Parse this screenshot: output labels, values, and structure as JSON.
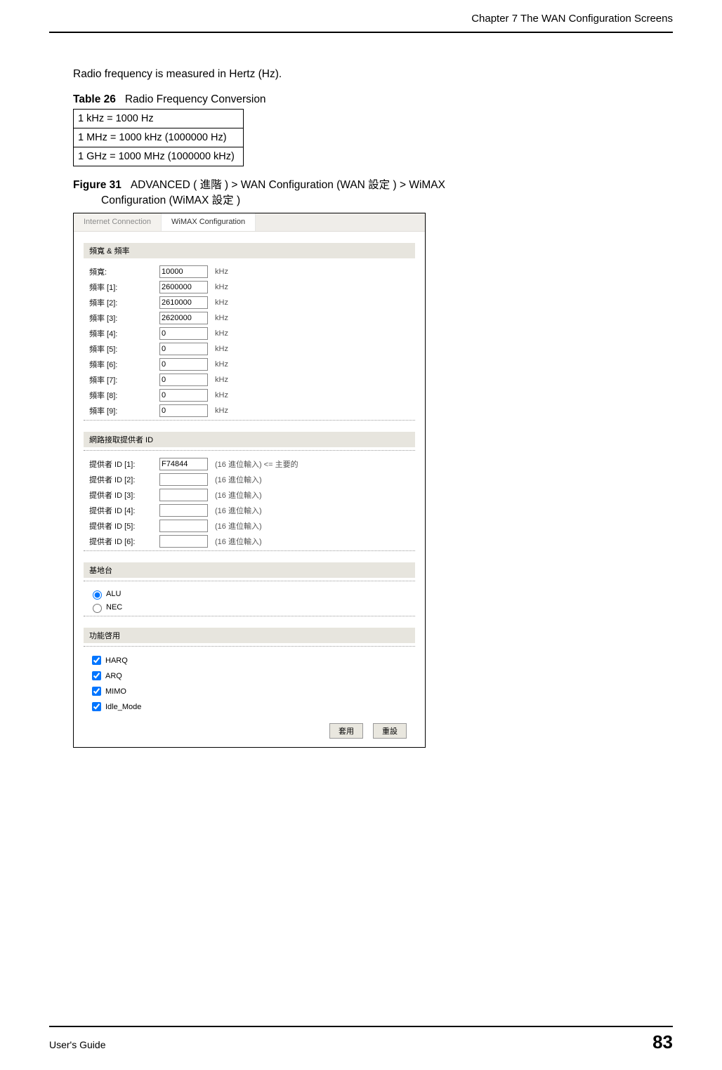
{
  "header": {
    "chapter": "Chapter 7 The WAN Configuration Screens"
  },
  "intro": "Radio frequency is measured in Hertz (Hz).",
  "table": {
    "label": "Table 26",
    "title": "Radio Frequency Conversion",
    "rows": [
      "1 kHz = 1000 Hz",
      "1 MHz = 1000 kHz (1000000 Hz)",
      "1 GHz = 1000 MHz (1000000 kHz)"
    ]
  },
  "figure": {
    "label": "Figure 31",
    "line1": "ADVANCED ( 進階 ) > WAN Configuration (WAN 設定 ) > WiMAX",
    "line2": "Configuration (WiMAX 設定 )"
  },
  "tabs": {
    "inactive": "Internet Connection",
    "active": "WiMAX Configuration"
  },
  "sections": {
    "freq": "頻寬 & 頻率",
    "provider": "網路接取提供者 ID",
    "base": "基地台",
    "feature": "功能啓用"
  },
  "freq": {
    "unit": "kHz",
    "rows": [
      {
        "label": "頻寬:",
        "value": "10000"
      },
      {
        "label": "頻率 [1]:",
        "value": "2600000"
      },
      {
        "label": "頻率 [2]:",
        "value": "2610000"
      },
      {
        "label": "頻率 [3]:",
        "value": "2620000"
      },
      {
        "label": "頻率 [4]:",
        "value": "0"
      },
      {
        "label": "頻率 [5]:",
        "value": "0"
      },
      {
        "label": "頻率 [6]:",
        "value": "0"
      },
      {
        "label": "頻率 [7]:",
        "value": "0"
      },
      {
        "label": "頻率 [8]:",
        "value": "0"
      },
      {
        "label": "頻率 [9]:",
        "value": "0"
      }
    ]
  },
  "provider": {
    "primary_hint": "(16 進位輸入) <= 主要的",
    "hint": "(16 進位輸入)",
    "rows": [
      {
        "label": "提供者 ID [1]:",
        "value": "F74844",
        "primary": true
      },
      {
        "label": "提供者 ID [2]:",
        "value": ""
      },
      {
        "label": "提供者 ID [3]:",
        "value": ""
      },
      {
        "label": "提供者 ID [4]:",
        "value": ""
      },
      {
        "label": "提供者 ID [5]:",
        "value": ""
      },
      {
        "label": "提供者 ID [6]:",
        "value": ""
      }
    ]
  },
  "base": {
    "options": [
      "ALU",
      "NEC"
    ],
    "selected": "ALU"
  },
  "features": {
    "options": [
      "HARQ",
      "ARQ",
      "MIMO",
      "Idle_Mode"
    ],
    "checked": [
      "HARQ",
      "ARQ",
      "MIMO",
      "Idle_Mode"
    ]
  },
  "buttons": {
    "apply": "套用",
    "reset": "重設"
  },
  "footer": {
    "guide": "User's Guide",
    "page": "83"
  }
}
